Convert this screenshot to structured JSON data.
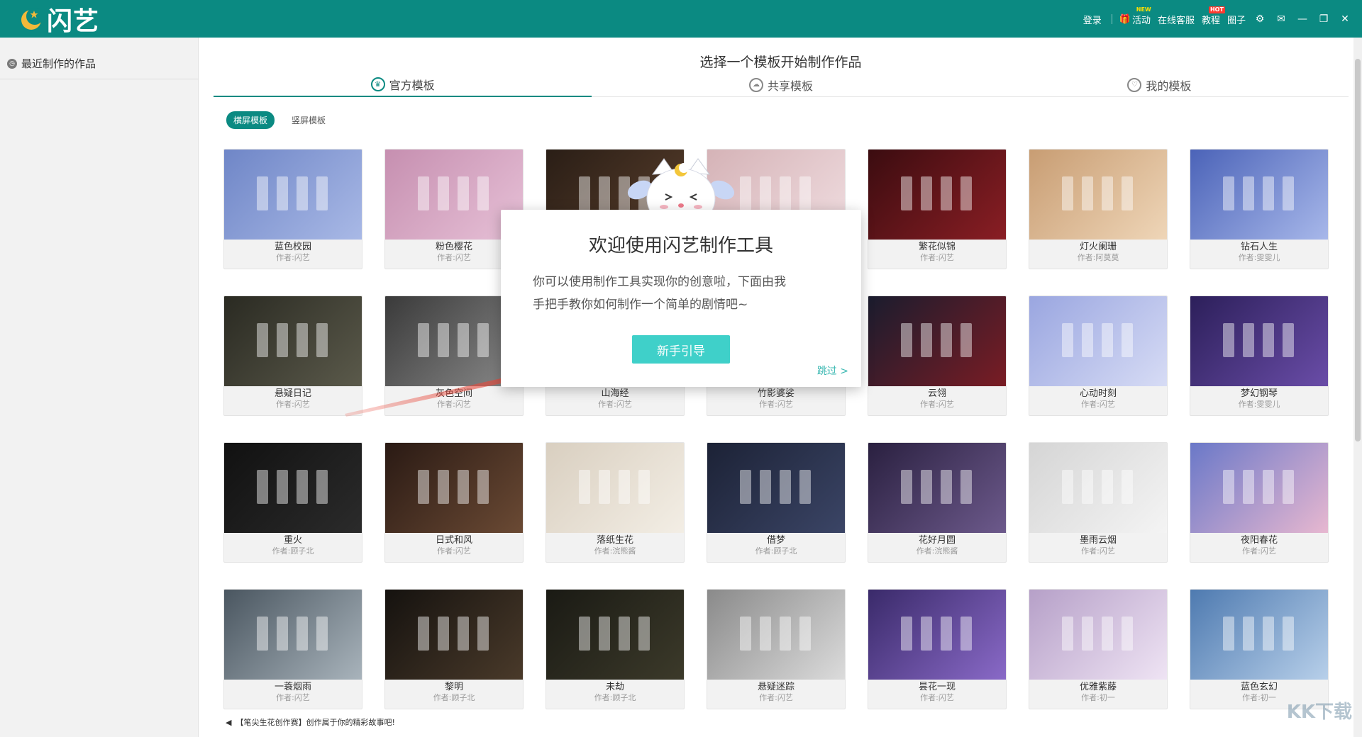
{
  "app": {
    "logo_text": "闪艺"
  },
  "topbar": {
    "login": "登录",
    "activity": "活动",
    "activity_badge": "NEW",
    "service": "在线客服",
    "tutorial": "教程",
    "tutorial_badge": "HOT",
    "circle": "圈子"
  },
  "sidebar": {
    "recent": "最近制作的作品"
  },
  "main": {
    "title": "选择一个模板开始制作作品",
    "tabs": [
      {
        "label": "官方模板"
      },
      {
        "label": "共享模板"
      },
      {
        "label": "我的模板"
      }
    ],
    "subtabs": [
      {
        "label": "横屏模板"
      },
      {
        "label": "竖屏模板"
      }
    ]
  },
  "templates": [
    {
      "name": "蓝色校园",
      "author": "作者:闪艺",
      "bg": "#6f86c7",
      "bg2": "#a9b9e6"
    },
    {
      "name": "粉色樱花",
      "author": "作者:闪艺",
      "bg": "#c68fb0",
      "bg2": "#e7c1d7"
    },
    {
      "name": "",
      "author": "",
      "bg": "#2a1e16",
      "bg2": "#5a3f2c"
    },
    {
      "name": "",
      "author": "",
      "bg": "#d5b3b7",
      "bg2": "#f0dde0"
    },
    {
      "name": "繁花似锦",
      "author": "作者:闪艺",
      "bg": "#3b0c10",
      "bg2": "#8a1e24"
    },
    {
      "name": "灯火阑珊",
      "author": "作者:阿莫莫",
      "bg": "#c89d73",
      "bg2": "#efd6b8"
    },
    {
      "name": "钻石人生",
      "author": "作者:雯雯儿",
      "bg": "#4b63b8",
      "bg2": "#a8b8ea"
    },
    {
      "name": "悬疑日记",
      "author": "作者:闪艺",
      "bg": "#2a2a22",
      "bg2": "#5b5a4b"
    },
    {
      "name": "灰色空间",
      "author": "作者:闪艺",
      "bg": "#3a3a3a",
      "bg2": "#8a8a8a"
    },
    {
      "name": "山海经",
      "author": "作者:闪艺",
      "bg": "#3d4a38",
      "bg2": "#7e8c6a"
    },
    {
      "name": "竹影婆娑",
      "author": "作者:闪艺",
      "bg": "#34492e",
      "bg2": "#728a5c"
    },
    {
      "name": "云翎",
      "author": "作者:闪艺",
      "bg": "#1a1c2e",
      "bg2": "#7a1c24"
    },
    {
      "name": "心动时刻",
      "author": "作者:闪艺",
      "bg": "#9aa6e0",
      "bg2": "#d7dcf5"
    },
    {
      "name": "梦幻钢琴",
      "author": "作者:雯雯儿",
      "bg": "#2c1f5a",
      "bg2": "#6a4da8"
    },
    {
      "name": "重火",
      "author": "作者:顾子北",
      "bg": "#111111",
      "bg2": "#2b2b2b"
    },
    {
      "name": "日式和风",
      "author": "作者:闪艺",
      "bg": "#2a1a14",
      "bg2": "#6b4a34"
    },
    {
      "name": "落纸生花",
      "author": "作者:浣熊酱",
      "bg": "#d9cfc0",
      "bg2": "#f3eee5"
    },
    {
      "name": "借梦",
      "author": "作者:顾子北",
      "bg": "#1c2236",
      "bg2": "#3b4566"
    },
    {
      "name": "花好月圆",
      "author": "作者:浣熊酱",
      "bg": "#2a2040",
      "bg2": "#6d5a8c"
    },
    {
      "name": "墨雨云烟",
      "author": "作者:闪艺",
      "bg": "#d5d5d5",
      "bg2": "#f4f4f4"
    },
    {
      "name": "夜阳春花",
      "author": "作者:闪艺",
      "bg": "#6a78c8",
      "bg2": "#e8b8d0"
    },
    {
      "name": "一蓑烟雨",
      "author": "作者:闪艺",
      "bg": "#4a5660",
      "bg2": "#a9b4bc"
    },
    {
      "name": "黎明",
      "author": "作者:顾子北",
      "bg": "#15120f",
      "bg2": "#4a3a2a"
    },
    {
      "name": "未劫",
      "author": "作者:顾子北",
      "bg": "#1a1a14",
      "bg2": "#3c3a2a"
    },
    {
      "name": "悬疑迷踪",
      "author": "作者:闪艺",
      "bg": "#8a8a8a",
      "bg2": "#dcdcdc"
    },
    {
      "name": "昙花一现",
      "author": "作者:闪艺",
      "bg": "#3a2a6a",
      "bg2": "#8a6ac8"
    },
    {
      "name": "优雅紫藤",
      "author": "作者:初一",
      "bg": "#b6a0c8",
      "bg2": "#efe4f4"
    },
    {
      "name": "蓝色玄幻",
      "author": "作者:初一",
      "bg": "#4e7ab0",
      "bg2": "#b8d0ea"
    }
  ],
  "ticker": {
    "text": "【笔尖生花创作赛】创作属于你的精彩故事吧!"
  },
  "modal": {
    "title": "欢迎使用闪艺制作工具",
    "body_line1": "你可以使用制作工具实现你的创意啦，下面由我",
    "body_line2": "手把手教你如何制作一个简单的剧情吧~",
    "button": "新手引导",
    "skip": "跳过 >"
  },
  "watermark": "KK下载",
  "colors": {
    "brand": "#0b8a82",
    "button": "#3fd0c9",
    "arrow": "#e8483a"
  }
}
